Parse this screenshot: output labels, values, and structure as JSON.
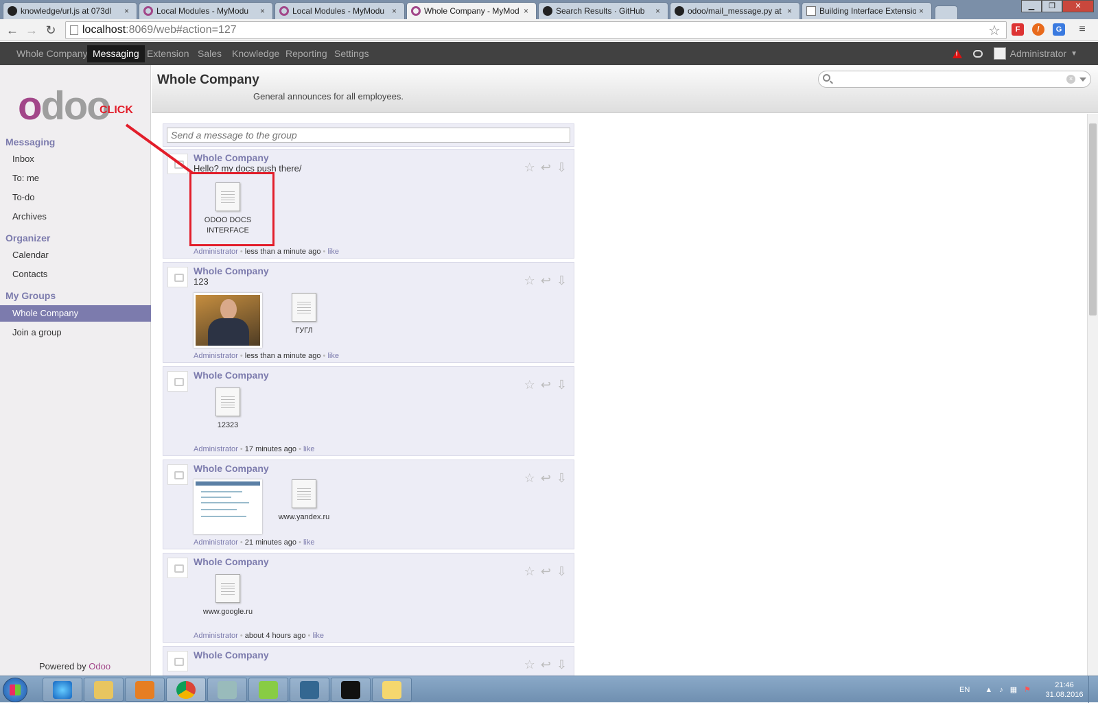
{
  "browser": {
    "tabs": [
      {
        "title": "knowledge/url.js at 073dl",
        "icon": "github-icon"
      },
      {
        "title": "Local Modules - MyModu",
        "icon": "odoo-icon"
      },
      {
        "title": "Local Modules - MyModu",
        "icon": "odoo-icon"
      },
      {
        "title": "Whole Company - MyMod",
        "icon": "odoo-icon",
        "active": true
      },
      {
        "title": "Search Results · GitHub",
        "icon": "github-icon"
      },
      {
        "title": "odoo/mail_message.py at",
        "icon": "github-icon"
      },
      {
        "title": "Building Interface Extensio",
        "icon": "page-icon"
      }
    ],
    "close_glyph": "×",
    "url_host": "localhost",
    "url_path": ":8069/web#action=127"
  },
  "topnav": {
    "menus": [
      "Whole Company",
      "Messaging",
      "Extension",
      "Sales",
      "Knowledge",
      "Reporting",
      "Settings"
    ],
    "active": "Messaging",
    "user": "Administrator"
  },
  "sidebar": {
    "sections": [
      {
        "title": "Messaging",
        "items": [
          "Inbox",
          "To: me",
          "To-do",
          "Archives"
        ]
      },
      {
        "title": "Organizer",
        "items": [
          "Calendar",
          "Contacts"
        ]
      },
      {
        "title": "My Groups",
        "items": [
          "Whole Company",
          "Join a group"
        ]
      }
    ],
    "active_item": "Whole Company",
    "logo_text": "odoo",
    "powered_by": "Powered by",
    "powered_brand": "Odoo"
  },
  "header": {
    "group_name": "Whole Company",
    "description": "General announces for all employees."
  },
  "search": {
    "placeholder": ""
  },
  "composer": {
    "placeholder": "Send a message to the group"
  },
  "messages": [
    {
      "group": "Whole Company",
      "body": "Hello? my docs push there/",
      "author": "Administrator",
      "time": "less than a minute ago",
      "like": "like",
      "attachments": [
        {
          "type": "file",
          "label": "ODOO DOCS INTERFACE"
        }
      ]
    },
    {
      "group": "Whole Company",
      "body": "123",
      "author": "Administrator",
      "time": "less than a minute ago",
      "like": "like",
      "attachments": [
        {
          "type": "image",
          "label": "photo"
        },
        {
          "type": "file",
          "label": "ГУГЛ"
        }
      ]
    },
    {
      "group": "Whole Company",
      "body": "",
      "author": "Administrator",
      "time": "17 minutes ago",
      "like": "like",
      "attachments": [
        {
          "type": "file",
          "label": "12323"
        }
      ]
    },
    {
      "group": "Whole Company",
      "body": "",
      "author": "Administrator",
      "time": "21 minutes ago",
      "like": "like",
      "attachments": [
        {
          "type": "image",
          "label": "screenshot"
        },
        {
          "type": "file",
          "label": "www.yandex.ru"
        }
      ]
    },
    {
      "group": "Whole Company",
      "body": "",
      "author": "Administrator",
      "time": "about 4 hours ago",
      "like": "like",
      "attachments": [
        {
          "type": "file",
          "label": "www.google.ru"
        }
      ]
    },
    {
      "group": "Whole Company",
      "body": "",
      "author": "",
      "time": "",
      "like": "",
      "attachments": []
    }
  ],
  "separator": "•",
  "annotation": {
    "label": "CLICK",
    "color": "#e21d2a"
  },
  "taskbar": {
    "lang": "EN",
    "time": "21:46",
    "date": "31.08.2016"
  },
  "colors": {
    "accent": "#7c7bad",
    "nav_bg": "#414141",
    "brand": "#a24689"
  }
}
